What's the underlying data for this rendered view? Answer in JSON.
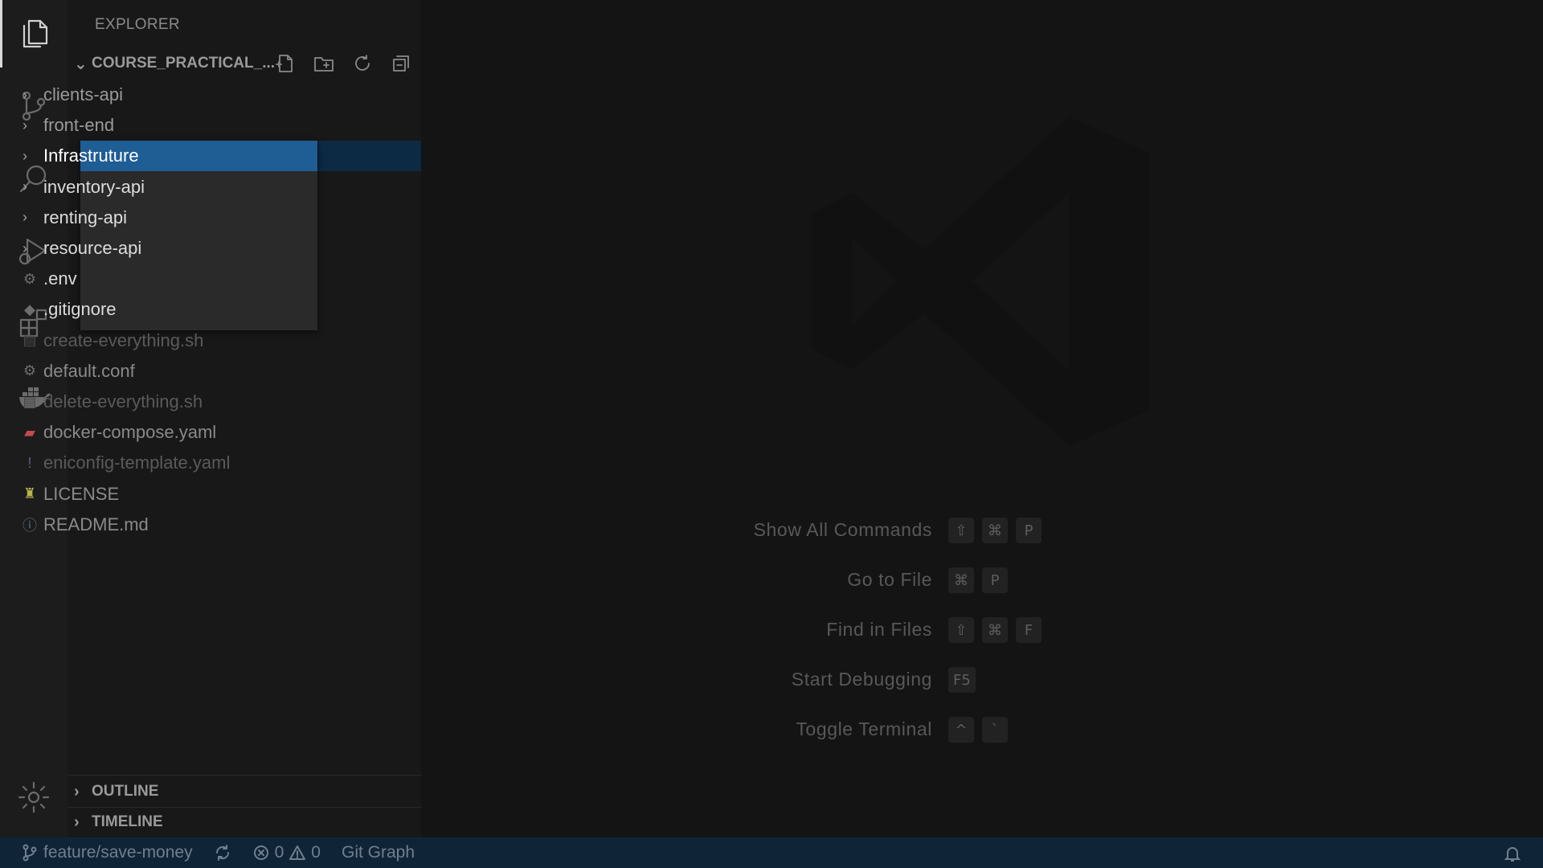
{
  "explorer": {
    "title": "EXPLORER",
    "folder_name": "COURSE_PRACTICAL_...",
    "actions": [
      "new-file-icon",
      "new-folder-icon",
      "refresh-icon",
      "collapse-all-icon"
    ],
    "items": [
      {
        "label": "clients-api",
        "type": "folder",
        "icon": "chevron-right-icon"
      },
      {
        "label": "front-end",
        "type": "folder",
        "icon": "chevron-right-icon"
      },
      {
        "label": "Infrastruture",
        "type": "folder",
        "icon": "chevron-right-icon",
        "selected": true
      },
      {
        "label": "inventory-api",
        "type": "folder",
        "icon": "chevron-right-icon"
      },
      {
        "label": "renting-api",
        "type": "folder",
        "icon": "chevron-right-icon"
      },
      {
        "label": "resource-api",
        "type": "folder",
        "icon": "chevron-right-icon"
      },
      {
        "label": ".env",
        "type": "file",
        "icon": "gear-icon"
      },
      {
        "label": ".gitignore",
        "type": "file",
        "icon": "git-icon"
      },
      {
        "label": "create-everything.sh",
        "type": "file",
        "icon": "shell-script-icon"
      },
      {
        "label": "default.conf",
        "type": "file",
        "icon": "gear-icon"
      },
      {
        "label": "delete-everything.sh",
        "type": "file",
        "icon": "shell-script-icon"
      },
      {
        "label": "docker-compose.yaml",
        "type": "file",
        "icon": "docker-icon"
      },
      {
        "label": "eniconfig-template.yaml",
        "type": "file",
        "icon": "yaml-icon"
      },
      {
        "label": "LICENSE",
        "type": "file",
        "icon": "license-icon"
      },
      {
        "label": "README.md",
        "type": "file",
        "icon": "info-icon"
      }
    ],
    "outline_label": "OUTLINE",
    "timeline_label": "TIMELINE"
  },
  "activity_bar": [
    "files-icon",
    "source-control-icon",
    "search-icon",
    "run-debug-icon",
    "extensions-icon",
    "docker-icon",
    "settings-gear-icon"
  ],
  "shortcuts": [
    {
      "label": "Show All Commands",
      "keys": [
        "⇧",
        "⌘",
        "P"
      ]
    },
    {
      "label": "Go to File",
      "keys": [
        "⌘",
        "P"
      ]
    },
    {
      "label": "Find in Files",
      "keys": [
        "⇧",
        "⌘",
        "F"
      ]
    },
    {
      "label": "Start Debugging",
      "keys": [
        "F5"
      ]
    },
    {
      "label": "Toggle Terminal",
      "keys": [
        "^",
        "`"
      ]
    }
  ],
  "status_bar": {
    "branch": "feature/save-money",
    "errors": "0",
    "warnings": "0",
    "git_graph": "Git Graph"
  },
  "colors": {
    "selection": "#1f5d95",
    "status_bar_bg": "#0f2437",
    "docker_icon": "#c24b50",
    "license_icon": "#b7b54b"
  }
}
